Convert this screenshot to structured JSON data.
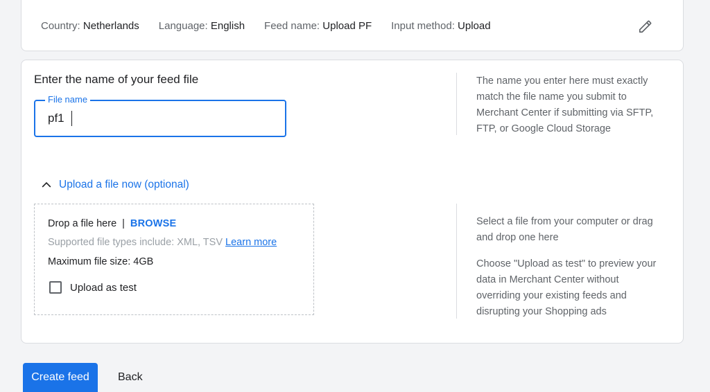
{
  "summary": {
    "country_label": "Country:",
    "country_value": "Netherlands",
    "language_label": "Language:",
    "language_value": "English",
    "feed_name_label": "Feed name:",
    "feed_name_value": "Upload PF",
    "input_method_label": "Input method:",
    "input_method_value": "Upload",
    "edit_icon": "pencil-icon"
  },
  "file_section": {
    "title": "Enter the name of your feed file",
    "field_label": "File name",
    "field_value": "pf1",
    "help_text": "The name you enter here must exactly match the file name you submit to Merchant Center if submitting via SFTP, FTP, or Google Cloud Storage"
  },
  "upload_section": {
    "toggle_label": "Upload a file now (optional)",
    "toggle_icon": "chevron-up-icon",
    "drop_text": "Drop a file here",
    "separator": "|",
    "browse_label": "BROWSE",
    "supported_text": "Supported file types include: XML, TSV",
    "learn_more_label": "Learn more",
    "max_size_text": "Maximum file size: 4GB",
    "checkbox_label": "Upload as test",
    "checkbox_checked": false,
    "help_text_1": "Select a file from your computer or drag and drop one here",
    "help_text_2": "Choose \"Upload as test\" to preview your data in Merchant Center without overriding your existing feeds and disrupting your Shopping ads"
  },
  "actions": {
    "create_label": "Create feed",
    "back_label": "Back"
  },
  "colors": {
    "accent": "#1a73e8",
    "text": "#202124",
    "muted": "#5f6368"
  }
}
